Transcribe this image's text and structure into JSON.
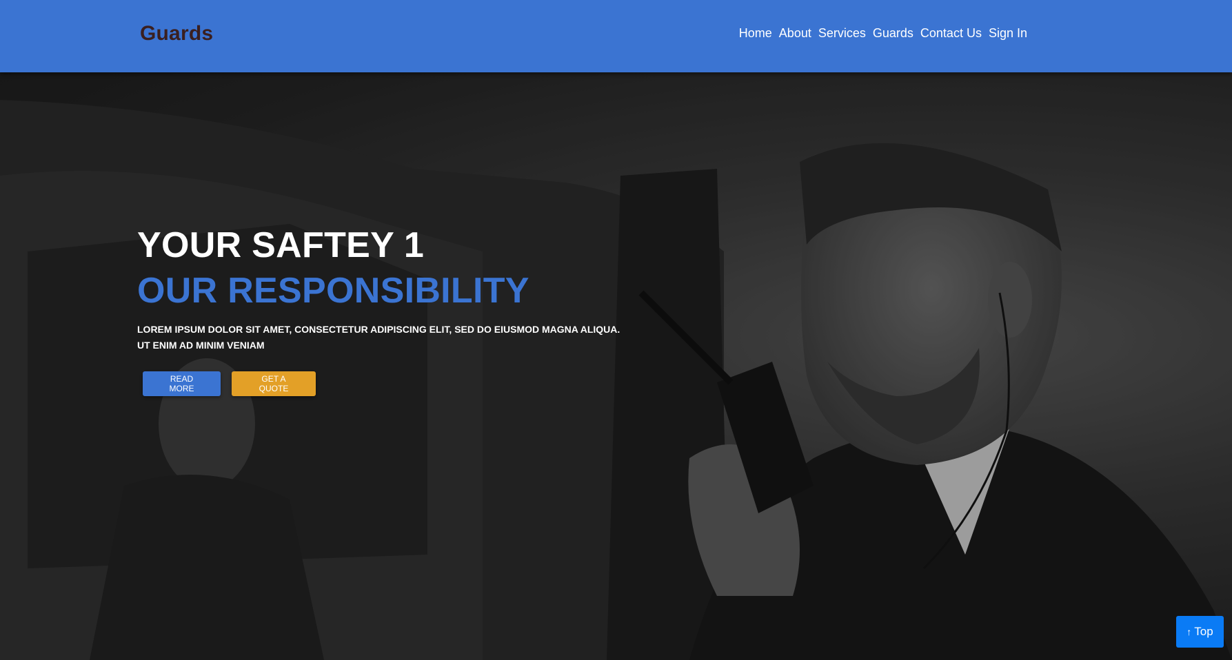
{
  "brand": {
    "name": "Guards",
    "color": "#3a1f1f"
  },
  "navbar": {
    "background": "#3b74d2",
    "links": [
      {
        "label": "Home"
      },
      {
        "label": "About"
      },
      {
        "label": "Services"
      },
      {
        "label": "Guards"
      },
      {
        "label": "Contact Us"
      },
      {
        "label": "Sign In"
      }
    ]
  },
  "hero": {
    "title": "YOUR SAFTEY 1",
    "subtitle": "OUR RESPONSIBILITY",
    "text_line1": "LOREM IPSUM DOLOR SIT AMET, CONSECTETUR ADIPISCING ELIT, SED DO EIUSMOD MAGNA ALIQUA.",
    "text_line2": "UT ENIM AD MINIM VENIAM",
    "buttons": {
      "read_more": "READ MORE",
      "get_quote": "GET A QUOTE"
    },
    "accent_color": "#3b74d2",
    "quote_color": "#e3a027"
  },
  "scroll_top": {
    "icon": "arrow-up-icon",
    "label": "Top",
    "color": "#0a7bf5"
  }
}
